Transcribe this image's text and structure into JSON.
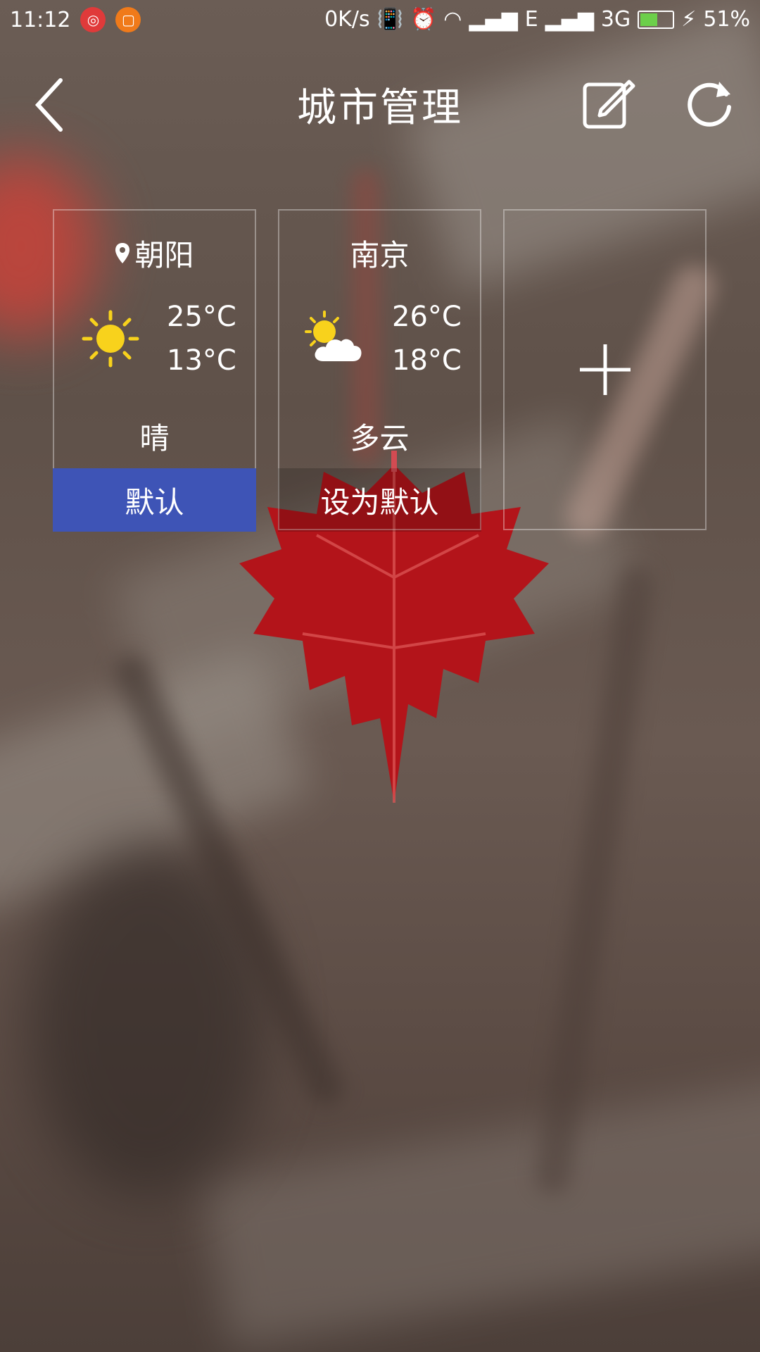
{
  "status_bar": {
    "time": "11:12",
    "speed": "0K/s",
    "network_e": "E",
    "network_3g": "3G",
    "battery": "51%"
  },
  "header": {
    "title": "城市管理"
  },
  "cities": [
    {
      "name": "朝阳",
      "high": "25°C",
      "low": "13°C",
      "condition": "晴",
      "button": "默认",
      "is_default": true,
      "icon": "sun-icon"
    },
    {
      "name": "南京",
      "high": "26°C",
      "low": "18°C",
      "condition": "多云",
      "button": "设为默认",
      "is_default": false,
      "icon": "partly-cloudy-icon"
    }
  ],
  "colors": {
    "default_button": "#3e54b6",
    "sun": "#f8d21c"
  }
}
